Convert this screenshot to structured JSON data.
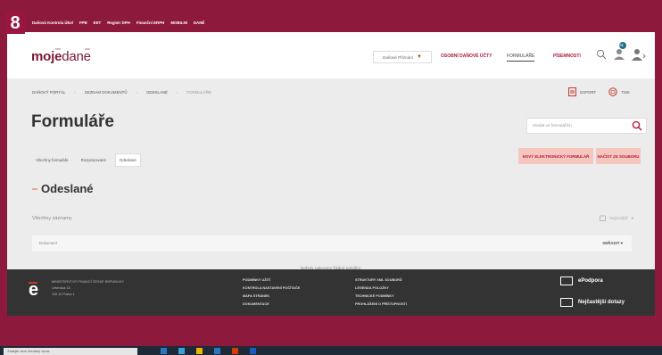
{
  "badge": "8",
  "topbar": {
    "links": [
      "Daňová Kontrola Úkol",
      "FPB",
      "EET",
      "Registr DPH",
      "Finanční ERPH",
      "MOBILNÍ",
      "DANĚ"
    ]
  },
  "header": {
    "logo_bold_1": "moj",
    "logo_e_1": "e",
    "logo_thin": "dan",
    "logo_e_2": "e",
    "office_select": "Daňové Přiznání",
    "nav": [
      {
        "label": "OSOBNÍ DAŇOVÉ ÚČTY"
      },
      {
        "label": "FORMULÁŘE"
      },
      {
        "label": "PÍSEMNOSTI"
      }
    ],
    "notif_count": "75"
  },
  "breadcrumb": [
    "DAŇOVÝ PORTÁL",
    "SEZNAM DOKUMENTŮ",
    "ODESLANÉ",
    "FORMULÁŘE"
  ],
  "tools": {
    "export": "EXPORT",
    "print": "TISK"
  },
  "page_title": "Formuláře",
  "search": {
    "placeholder": "Hledat ve formulářích"
  },
  "tabs": [
    {
      "label": "Všechny formuláře",
      "selected": false
    },
    {
      "label": "Rozpracované",
      "selected": false
    },
    {
      "label": "Odeslané",
      "selected": true
    }
  ],
  "actions": {
    "new_form": "NOVÝ ELEKTRONICKÝ FORMULÁŘ",
    "load_file": "NAČÍST ZE SOUBORU"
  },
  "section": {
    "title": "Odeslané"
  },
  "records": {
    "label": "Všechny záznamy",
    "filter": "Nejnovější",
    "column_1": "Dokument",
    "column_2": "SEŘADIT"
  },
  "empty_message": "Nebyly nalezeny žádné položky.",
  "footer": {
    "ministry": [
      "MINISTERSTVO FINANCÍ ČESKÉ REPUBLIKY",
      "Letenská 15",
      "118 10 Praha 1"
    ],
    "col1": [
      "PODMÍNKY UŽITÍ",
      "KONTROLA NASTAVENÍ POČÍTAČE",
      "MAPA STRÁNEK",
      "DOKUMENTACE"
    ],
    "col2": [
      "STRUKTURY XML SOUBORŮ",
      "LEGENDA POLOŽKY",
      "TECHNICKÉ PODMÍNKY",
      "PROHLÁŠENÍ O PŘÍSTUPNOSTI"
    ],
    "support_1": "ePodpora",
    "support_2": "Nejčastější dotazy"
  },
  "taskbar": {
    "search_placeholder": "Zadejte sem hledaný výraz"
  },
  "colors": {
    "accent": "#b2183f",
    "brand": "#7a1a35",
    "frame": "#8d1a3c",
    "button_bg": "#f5c6bd"
  }
}
